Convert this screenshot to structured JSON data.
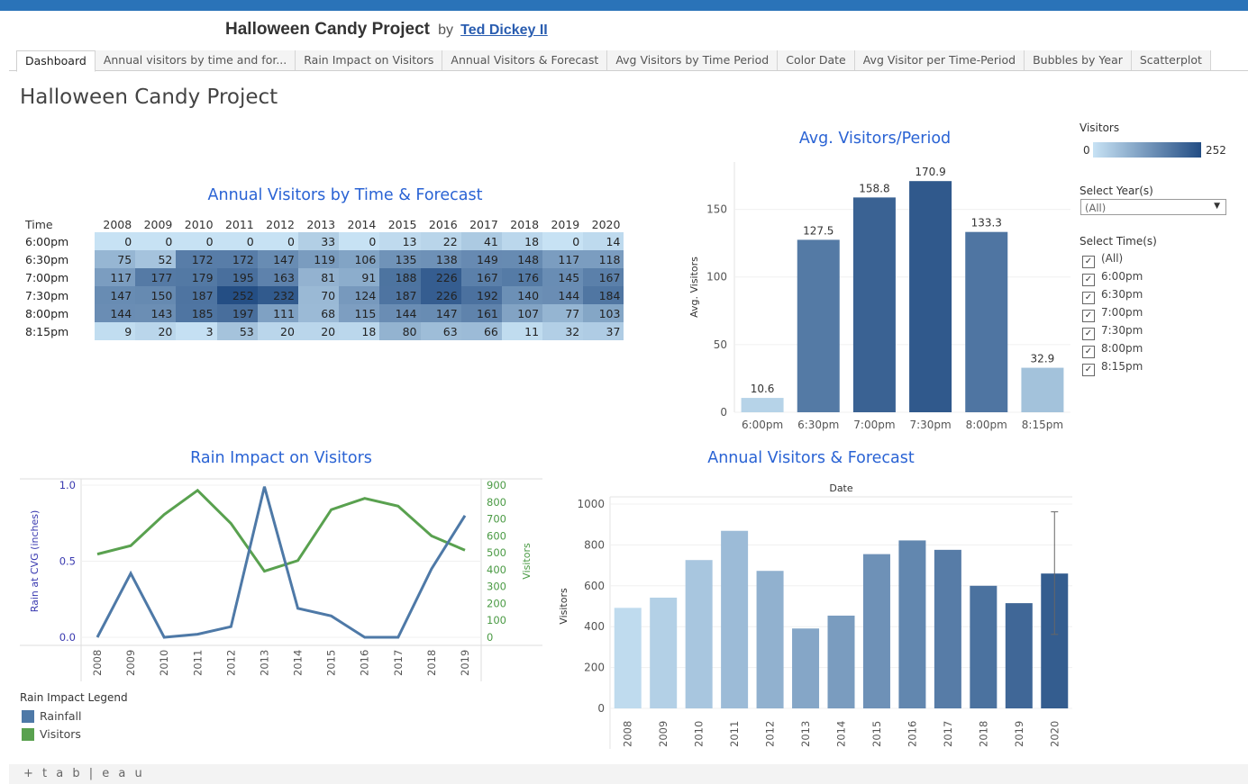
{
  "header": {
    "title": "Halloween Candy Project",
    "by": "by",
    "author": "Ted Dickey II"
  },
  "tabs": [
    "Dashboard",
    "Annual visitors by time and for...",
    "Rain Impact on Visitors",
    "Annual Visitors & Forecast",
    "Avg Visitors by Time Period",
    "Color Date",
    "Avg Visitor per Time-Period",
    "Bubbles by Year",
    "Scatterplot"
  ],
  "dashboard_title": "Halloween Candy Project",
  "filters": {
    "legend_title": "Visitors",
    "legend_min": "0",
    "legend_max": "252",
    "year_label": "Select Year(s)",
    "year_value": "(All)",
    "time_label": "Select Time(s)",
    "time_options": [
      "(All)",
      "6:00pm",
      "6:30pm",
      "7:00pm",
      "7:30pm",
      "8:00pm",
      "8:15pm"
    ]
  },
  "rain_legend": {
    "title": "Rain Impact Legend",
    "items": [
      "Rainfall",
      "Visitors"
    ],
    "colors": [
      "#4e79a7",
      "#59a14f"
    ]
  },
  "footer": {
    "logo": "+ t a b | e a u"
  },
  "chart_data": [
    {
      "type": "heatmap",
      "title": "Annual Visitors by Time & Forecast",
      "row_header": "Time",
      "columns": [
        "2008",
        "2009",
        "2010",
        "2011",
        "2012",
        "2013",
        "2014",
        "2015",
        "2016",
        "2017",
        "2018",
        "2019",
        "2020"
      ],
      "rows": [
        "6:00pm",
        "6:30pm",
        "7:00pm",
        "7:30pm",
        "8:00pm",
        "8:15pm"
      ],
      "values": [
        [
          0,
          0,
          0,
          0,
          0,
          33,
          0,
          13,
          22,
          41,
          18,
          0,
          14
        ],
        [
          75,
          52,
          172,
          172,
          147,
          119,
          106,
          135,
          138,
          149,
          148,
          117,
          118
        ],
        [
          117,
          177,
          179,
          195,
          163,
          81,
          91,
          188,
          226,
          167,
          176,
          145,
          167
        ],
        [
          147,
          150,
          187,
          252,
          232,
          70,
          124,
          187,
          226,
          192,
          140,
          144,
          184
        ],
        [
          144,
          143,
          185,
          197,
          111,
          68,
          115,
          144,
          147,
          161,
          107,
          77,
          103
        ],
        [
          9,
          20,
          3,
          53,
          20,
          20,
          18,
          80,
          63,
          66,
          11,
          32,
          37
        ]
      ],
      "color_range": [
        0,
        252
      ]
    },
    {
      "type": "bar",
      "title": "Avg. Visitors/Period",
      "ylabel": "Avg. Visitors",
      "categories": [
        "6:00pm",
        "6:30pm",
        "7:00pm",
        "7:30pm",
        "8:00pm",
        "8:15pm"
      ],
      "values": [
        10.6,
        127.5,
        158.8,
        170.9,
        133.3,
        32.9
      ],
      "labels": [
        "10.6",
        "127.5",
        "158.8",
        "170.9",
        "133.3",
        "32.9"
      ],
      "yticks": [
        0,
        50,
        100,
        150
      ],
      "ylim": [
        0,
        185
      ]
    },
    {
      "type": "line",
      "title": "Rain Impact on Visitors",
      "ylabel": "Rain at CVG (inches)",
      "y2label": "Visitors",
      "x": [
        "2008",
        "2009",
        "2010",
        "2011",
        "2012",
        "2013",
        "2014",
        "2015",
        "2016",
        "2017",
        "2018",
        "2019"
      ],
      "series": [
        {
          "name": "Rainfall",
          "axis": "left",
          "values": [
            0.0,
            0.42,
            0.0,
            0.02,
            0.07,
            0.99,
            0.19,
            0.14,
            0.0,
            0.0,
            0.45,
            0.8
          ]
        },
        {
          "name": "Visitors",
          "axis": "right",
          "values": [
            492,
            542,
            726,
            869,
            673,
            391,
            454,
            755,
            822,
            776,
            600,
            515
          ]
        }
      ],
      "yticks": [
        "0.0",
        "0.5",
        "1.0"
      ],
      "y2ticks": [
        "0",
        "100",
        "200",
        "300",
        "400",
        "500",
        "600",
        "700",
        "800",
        "900"
      ],
      "ylim": [
        0,
        1.0
      ],
      "y2lim": [
        0,
        900
      ]
    },
    {
      "type": "bar",
      "title": "Annual Visitors & Forecast",
      "xlabel": "Date",
      "ylabel": "Visitors",
      "categories": [
        "2008",
        "2009",
        "2010",
        "2011",
        "2012",
        "2013",
        "2014",
        "2015",
        "2016",
        "2017",
        "2018",
        "2019",
        "2020"
      ],
      "values": [
        492,
        542,
        726,
        869,
        673,
        391,
        454,
        755,
        822,
        776,
        600,
        515,
        660
      ],
      "forecast_range": [
        362,
        962
      ],
      "yticks": [
        0,
        200,
        400,
        600,
        800,
        1000
      ],
      "ylim": [
        0,
        1000
      ]
    }
  ]
}
